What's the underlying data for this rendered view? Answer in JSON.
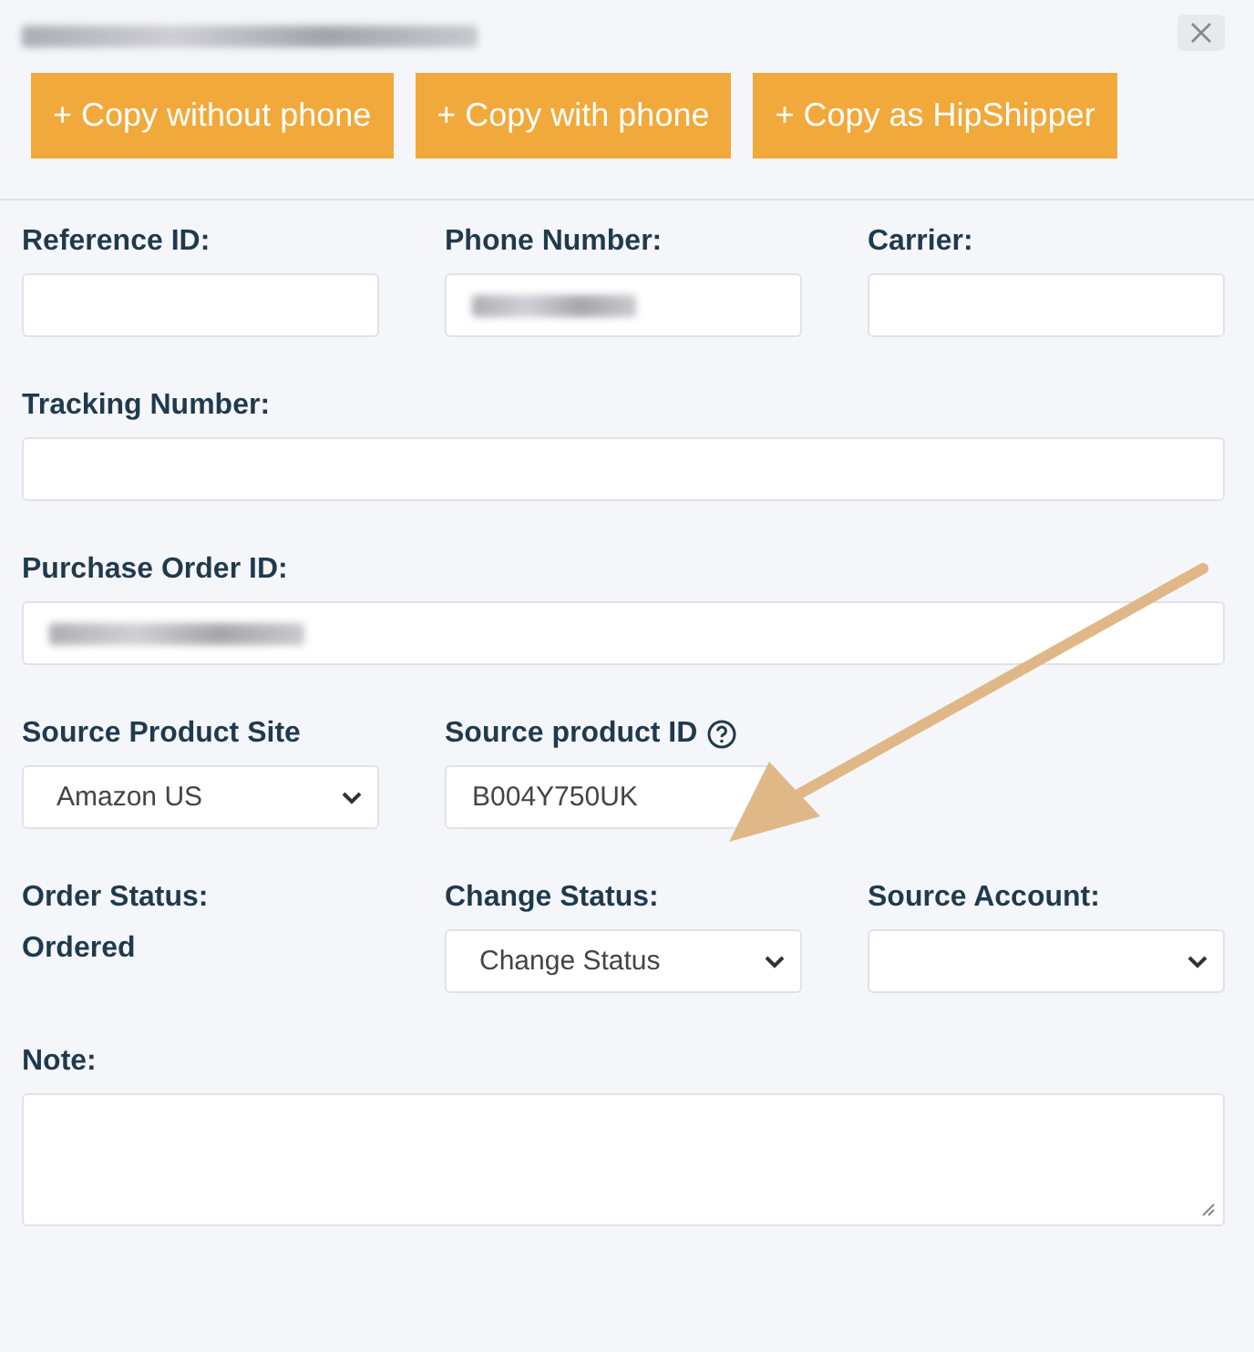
{
  "header": {
    "title_redacted": true
  },
  "buttons": [
    "+ Copy without phone",
    "+ Copy with phone",
    "+ Copy as HipShipper"
  ],
  "rows": [
    [
      {
        "label": "Reference ID:",
        "kind": "text"
      },
      {
        "label": "Phone Number:",
        "kind": "text",
        "redacted": true
      },
      {
        "label": "Carrier:",
        "kind": "text"
      }
    ],
    [
      {
        "label": "Tracking Number:",
        "kind": "text"
      }
    ],
    [
      {
        "label": "Purchase Order ID:",
        "kind": "text",
        "redacted": true
      }
    ],
    [
      {
        "label": "Source Product Site",
        "kind": "select",
        "value": "Amazon US"
      },
      {
        "label": "Source product ID",
        "kind": "short_text",
        "value": "B004Y750UK",
        "help": true
      }
    ],
    [
      {
        "label": "Order Status:",
        "kind": "static",
        "value": "Ordered"
      },
      {
        "label": "Change Status:",
        "kind": "select",
        "value": "Change Status"
      },
      {
        "label": "Source Account:",
        "kind": "select"
      }
    ],
    [
      {
        "label": "Note:",
        "kind": "textarea"
      }
    ]
  ]
}
